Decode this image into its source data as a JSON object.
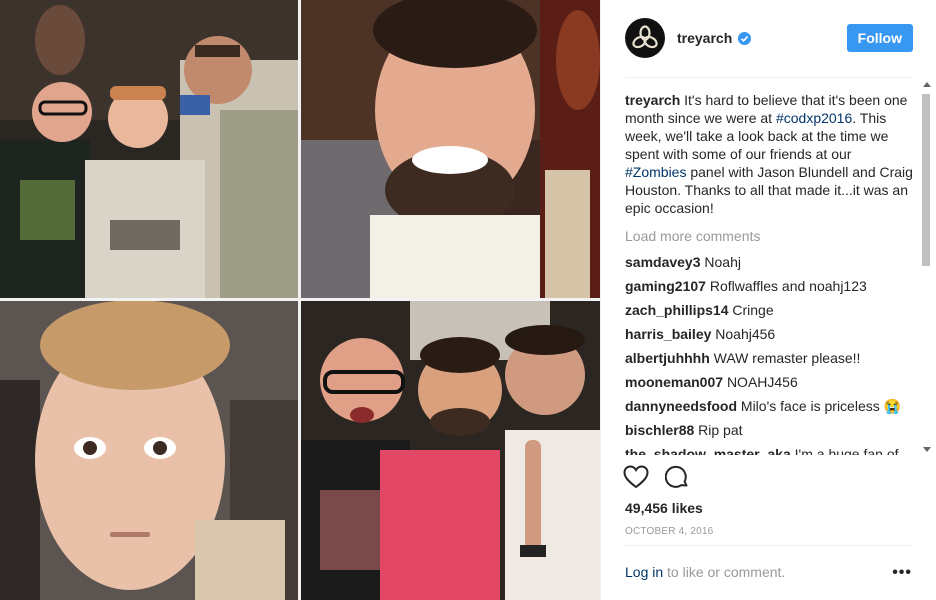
{
  "post": {
    "author": "treyarch",
    "follow_label": "Follow",
    "caption": {
      "username": "treyarch",
      "text_1": " It's hard to believe that it's been one month since we were at ",
      "hashtag_1": "#codxp2016",
      "text_2": ". This week, we'll take a look back at the time we spent with some of our friends at our ",
      "hashtag_2": "#Zombies",
      "text_3": " panel with Jason Blundell and Craig Houston. Thanks to all that made it...it was an epic occasion!"
    },
    "load_more": "Load more comments",
    "comments": [
      {
        "user": "samdavey3",
        "text": "Noahj"
      },
      {
        "user": "gaming2107",
        "text": "Roflwaffles and noahj123"
      },
      {
        "user": "zach_phillips14",
        "text": "Cringe"
      },
      {
        "user": "harris_bailey",
        "text": "Noahj456"
      },
      {
        "user": "albertjuhhhh",
        "text": "WAW remaster please!!"
      },
      {
        "user": "mooneman007",
        "text": "NOAHJ456"
      },
      {
        "user": "dannyneedsfood",
        "text": "Milo's face is priceless 😭"
      },
      {
        "user": "bischler88",
        "text": "Rip pat"
      },
      {
        "user": "the_shadow_master_aka",
        "text": "I'm a huge fan of"
      }
    ],
    "likes": "49,456 likes",
    "date": "OCTOBER 4, 2016",
    "footer": {
      "login_label": "Log in",
      "rest": " to like or comment.",
      "more": "•••"
    }
  },
  "icons": {
    "heart": "heart-icon",
    "comment": "comment-icon",
    "verified": "verified-badge-icon",
    "avatar": "treyarch-logo"
  },
  "colors": {
    "accent": "#3897f0",
    "link": "#003569",
    "muted": "#999999"
  }
}
